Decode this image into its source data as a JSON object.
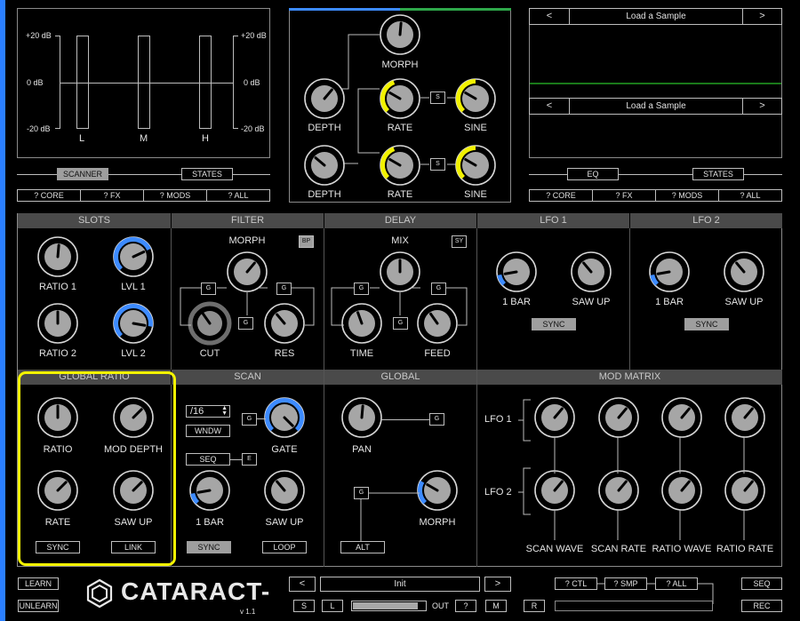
{
  "colors": {
    "accent_blue": "#3d8bff",
    "accent_yellow": "#f2f200",
    "highlight": "#f4f400",
    "grey": "#9e9e9e",
    "waveform_green": "#1a7a1a"
  },
  "meters": {
    "db_top": "+20 dB",
    "db_mid": "0 dB",
    "db_bot": "-20 dB",
    "bands": [
      "L",
      "M",
      "H"
    ]
  },
  "scanner_tabs": {
    "scanner": "SCANNER",
    "states": "STATES"
  },
  "help_left": {
    "core": "? CORE",
    "fx": "? FX",
    "mods": "? MODS",
    "all": "? ALL"
  },
  "morph_panel": {
    "morph": "MORPH",
    "depth1": "DEPTH",
    "rate1": "RATE",
    "sine1": "SINE",
    "depth2": "DEPTH",
    "rate2": "RATE",
    "sine2": "SINE",
    "s_label": "S"
  },
  "sample": {
    "prev": "<",
    "next": ">",
    "slot1": "Load a Sample",
    "slot2": "Load a Sample"
  },
  "right_tabs": {
    "eq": "EQ",
    "states": "STATES"
  },
  "help_right": {
    "core": "? CORE",
    "fx": "? FX",
    "mods": "? MODS",
    "all": "? ALL"
  },
  "slots": {
    "header": "SLOTS",
    "ratio1": "RATIO 1",
    "lvl1": "LVL 1",
    "ratio2": "RATIO 2",
    "lvl2": "LVL 2"
  },
  "filter": {
    "header": "FILTER",
    "morph": "MORPH",
    "bp": "BP",
    "cut": "CUT",
    "res": "RES",
    "g": "G"
  },
  "delay": {
    "header": "DELAY",
    "mix": "MIX",
    "sy": "SY",
    "time": "TIME",
    "feed": "FEED",
    "g": "G"
  },
  "lfo1": {
    "header": "LFO 1",
    "bar": "1 BAR",
    "saw": "SAW UP",
    "sync": "SYNC"
  },
  "lfo2": {
    "header": "LFO 2",
    "bar": "1 BAR",
    "saw": "SAW UP",
    "sync": "SYNC"
  },
  "global_ratio": {
    "header": "GLOBAL RATIO",
    "ratio": "RATIO",
    "mod_depth": "MOD DEPTH",
    "rate": "RATE",
    "saw": "SAW UP",
    "sync": "SYNC",
    "link": "LINK"
  },
  "scan": {
    "header": "SCAN",
    "division": "/16",
    "wndw": "WNDW",
    "gate": "GATE",
    "seq": "SEQ",
    "e": "E",
    "g": "G",
    "bar": "1 BAR",
    "saw": "SAW UP",
    "sync": "SYNC",
    "loop": "LOOP"
  },
  "global": {
    "header": "GLOBAL",
    "pan": "PAN",
    "morph": "MORPH",
    "alt": "ALT",
    "g": "G"
  },
  "modmatrix": {
    "header": "MOD MATRIX",
    "lfo1": "LFO 1",
    "lfo2": "LFO 2",
    "cols": [
      "SCAN WAVE",
      "SCAN RATE",
      "RATIO WAVE",
      "RATIO RATE"
    ]
  },
  "bottom": {
    "learn": "LEARN",
    "unlearn": "UNLEARN",
    "brand": "CATARACT",
    "version": "v 1.1",
    "prev": "<",
    "preset": "Init",
    "next": ">",
    "s": "S",
    "l": "L",
    "out": "OUT",
    "q": "?",
    "m": "M",
    "r": "R",
    "ctl": "? CTL",
    "smp": "? SMP",
    "all": "? ALL",
    "seq": "SEQ",
    "rec": "REC"
  }
}
